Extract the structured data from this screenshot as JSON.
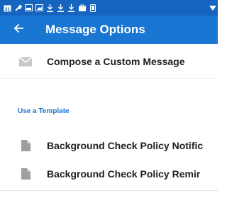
{
  "statusbar": {
    "icons": [
      "calendar-icon",
      "wrench-icon",
      "image-icon",
      "photo-icon",
      "download-icon",
      "download-icon",
      "download-icon",
      "bag-icon",
      "phone-icon",
      "signal-icon"
    ]
  },
  "appbar": {
    "title": "Message Options",
    "back_icon": "arrow-left-icon"
  },
  "compose": {
    "label": "Compose a Custom Message",
    "icon": "envelope-icon"
  },
  "templates": {
    "section_label": "Use a Template",
    "items": [
      {
        "label": "Background Check Policy Notific",
        "icon": "document-icon"
      },
      {
        "label": "Background Check Policy Remir",
        "icon": "document-icon"
      }
    ]
  },
  "colors": {
    "status_bar": "#1565c0",
    "app_bar": "#1976d2",
    "accent": "#1976d2",
    "icon_grey": "#9e9e9e"
  }
}
